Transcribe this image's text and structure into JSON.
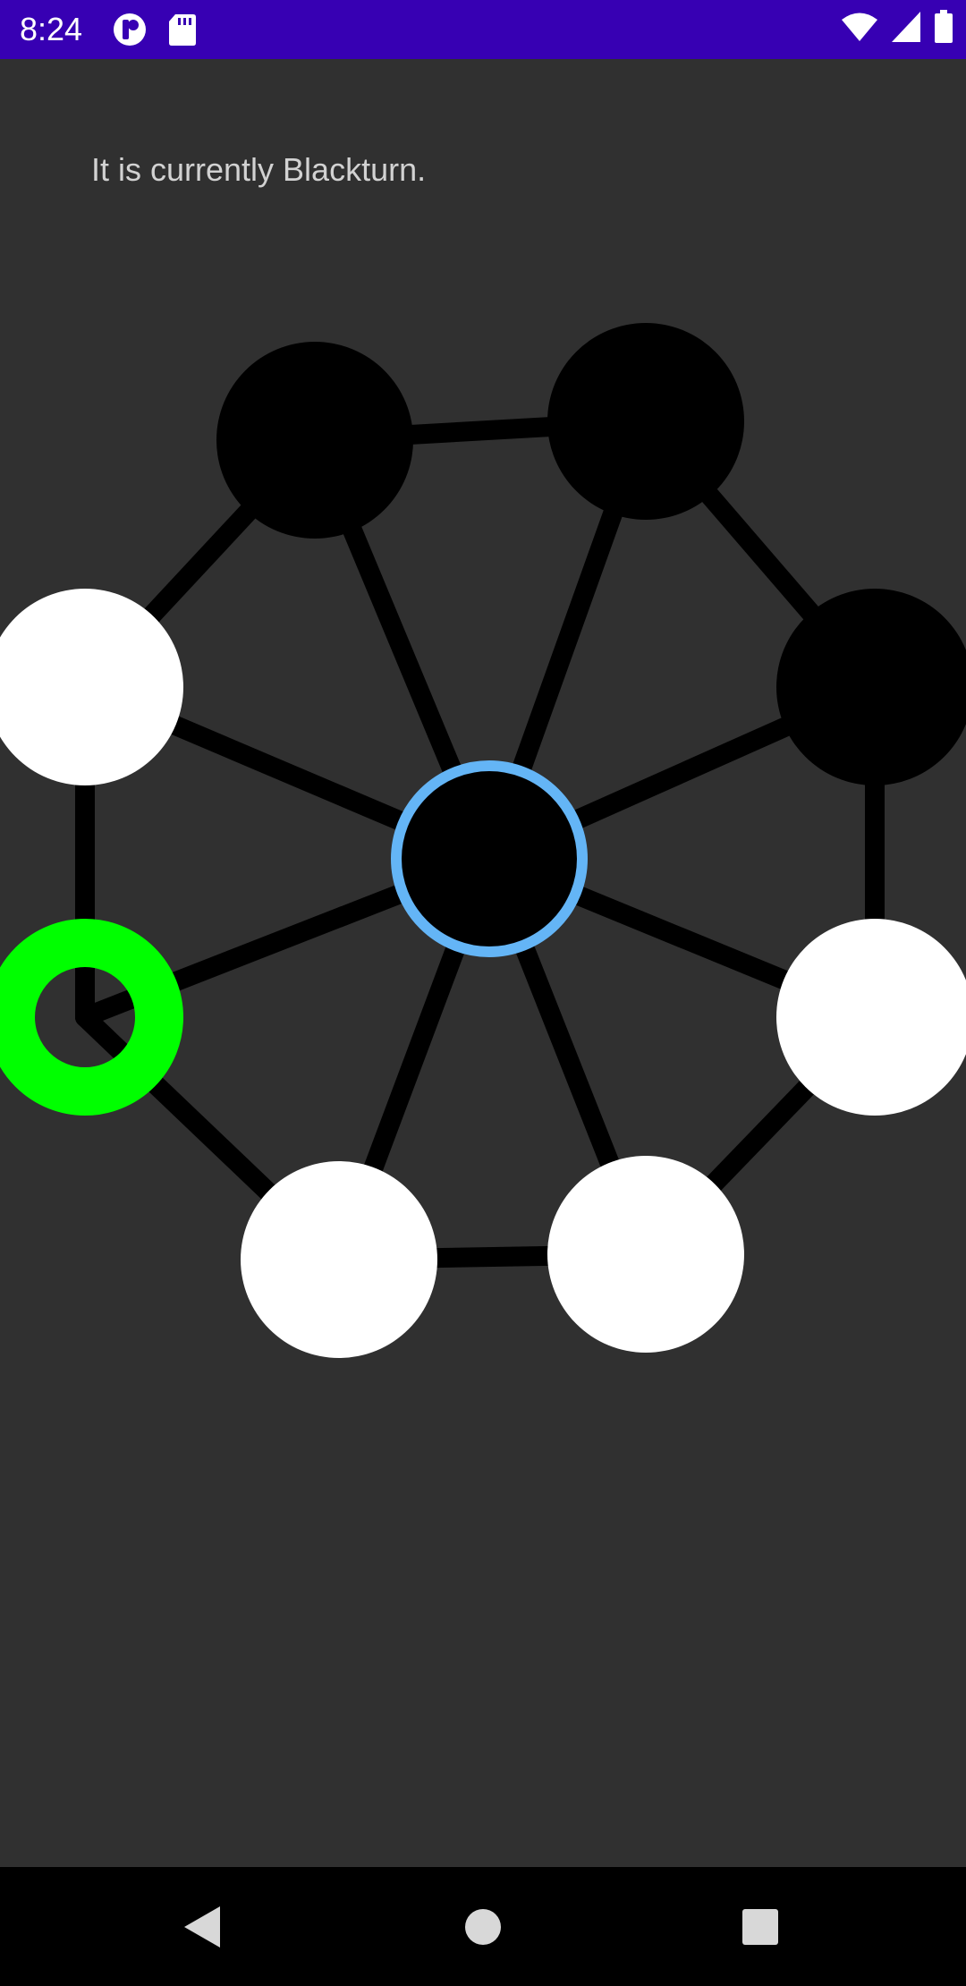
{
  "status_bar": {
    "time": "8:24",
    "left_icons": [
      "app-notification-icon",
      "sd-card-icon"
    ],
    "right_icons": [
      "wifi-icon",
      "cellular-signal-icon",
      "battery-icon"
    ],
    "background_color": "#3700b3"
  },
  "game": {
    "turn_message": "It is currently Blackturn.",
    "background_color": "#303030",
    "colors": {
      "black_piece": "#000000",
      "white_piece": "#ffffff",
      "selected_ring": "#64b5f6",
      "move_target": "#00ff00",
      "board_line": "#000000"
    },
    "board": {
      "center": {
        "id": "center",
        "piece": "black",
        "state": "selected"
      },
      "ring_positions": [
        {
          "id": "top-left",
          "piece": "black",
          "state": "normal"
        },
        {
          "id": "top-right",
          "piece": "black",
          "state": "normal"
        },
        {
          "id": "right-upper",
          "piece": "black",
          "state": "normal"
        },
        {
          "id": "right-lower",
          "piece": "white",
          "state": "normal"
        },
        {
          "id": "bottom-right",
          "piece": "white",
          "state": "normal"
        },
        {
          "id": "bottom-left",
          "piece": "white",
          "state": "normal"
        },
        {
          "id": "left-lower",
          "piece": "empty",
          "state": "move-target"
        },
        {
          "id": "left-upper",
          "piece": "white",
          "state": "normal"
        }
      ]
    }
  },
  "nav_bar": {
    "buttons": [
      "back-icon",
      "home-icon",
      "recents-icon"
    ]
  }
}
